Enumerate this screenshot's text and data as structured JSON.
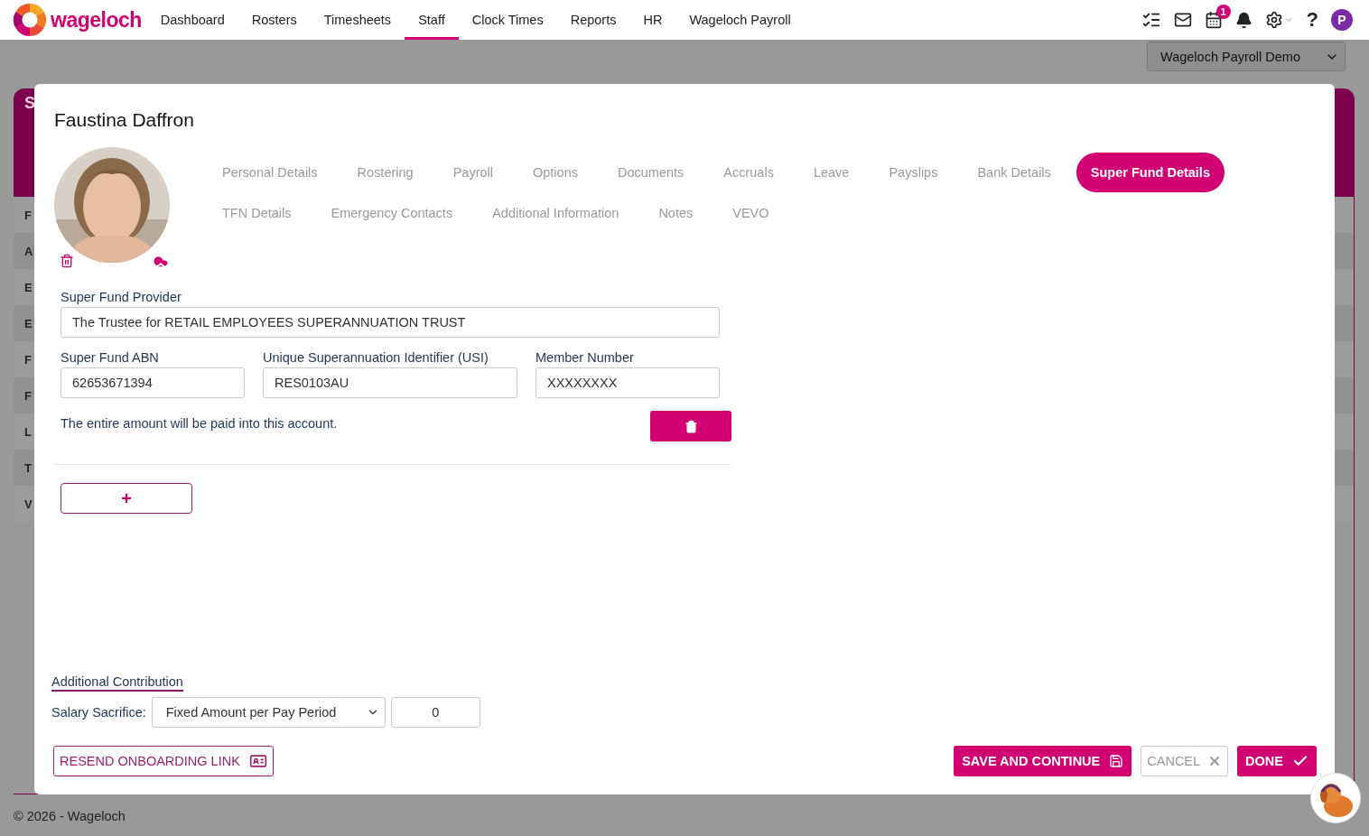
{
  "nav": {
    "brand": "wageloch",
    "items": [
      {
        "label": "Dashboard",
        "selected": false
      },
      {
        "label": "Rosters",
        "selected": false
      },
      {
        "label": "Timesheets",
        "selected": false
      },
      {
        "label": "Staff",
        "selected": true
      },
      {
        "label": "Clock Times",
        "selected": false
      },
      {
        "label": "Reports",
        "selected": false
      },
      {
        "label": "HR",
        "selected": false
      },
      {
        "label": "Wageloch Payroll",
        "selected": false
      }
    ],
    "calendar_badge": "1",
    "help": "?",
    "avatar_letter": "P"
  },
  "company_select": {
    "value": "Wageloch Payroll Demo"
  },
  "background_panel": {
    "title": "S",
    "rows": [
      "F",
      "A",
      "E",
      "E",
      "F",
      "F",
      "L",
      "T",
      "V"
    ]
  },
  "modal": {
    "title": "Faustina Daffron",
    "tab_rows": [
      [
        {
          "label": "Personal Details",
          "selected": false
        },
        {
          "label": "Rostering",
          "selected": false
        },
        {
          "label": "Payroll",
          "selected": false
        },
        {
          "label": "Options",
          "selected": false
        },
        {
          "label": "Documents",
          "selected": false
        },
        {
          "label": "Accruals",
          "selected": false
        },
        {
          "label": "Leave",
          "selected": false
        },
        {
          "label": "Payslips",
          "selected": false
        },
        {
          "label": "Bank Details",
          "selected": false
        },
        {
          "label": "Super Fund Details",
          "selected": true
        }
      ],
      [
        {
          "label": "TFN Details",
          "selected": false
        },
        {
          "label": "Emergency Contacts",
          "selected": false
        },
        {
          "label": "Additional Information",
          "selected": false
        },
        {
          "label": "Notes",
          "selected": false
        },
        {
          "label": "VEVO",
          "selected": false
        }
      ]
    ],
    "fund": {
      "provider_label": "Super Fund Provider",
      "provider_value": "The Trustee for RETAIL EMPLOYEES SUPERANNUATION TRUST",
      "abn_label": "Super Fund ABN",
      "abn_value": "62653671394",
      "usi_label": "Unique Superannuation Identifier (USI)",
      "usi_value": "RES0103AU",
      "member_label": "Member Number",
      "member_value": "XXXXXXXX",
      "note": "The entire amount will be paid into this account."
    },
    "add_button": "+",
    "additional_contribution": {
      "heading": "Additional Contribution",
      "salary_sacrifice_label": "Salary Sacrifice:",
      "type_value": "Fixed Amount per Pay Period",
      "amount_value": "0"
    },
    "buttons": {
      "resend": "RESEND ONBOARDING LINK",
      "save": "SAVE AND CONTINUE",
      "cancel": "CANCEL",
      "done": "DONE"
    }
  },
  "footer": "© 2026 - Wageloch"
}
